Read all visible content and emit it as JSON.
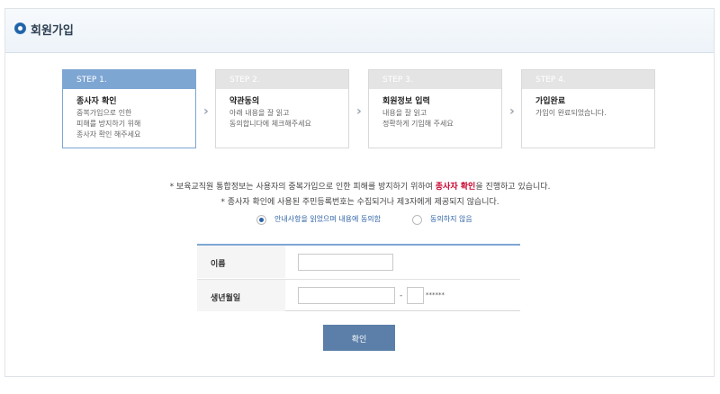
{
  "header": {
    "title": "회원가입"
  },
  "steps": [
    {
      "label": "STEP 1.",
      "title": "종사자 확인",
      "desc": [
        "중복가입으로 인한",
        "피해를 방지하기 위해",
        "종사자 확인 해주세요"
      ]
    },
    {
      "label": "STEP 2.",
      "title": "약관동의",
      "desc": [
        "아래 내용을 잘 읽고",
        "동의합니다에 체크해주세요"
      ]
    },
    {
      "label": "STEP 3.",
      "title": "회원정보 입력",
      "desc": [
        "내용을 잘 읽고",
        "정확하게 기입해 주세요"
      ]
    },
    {
      "label": "STEP 4.",
      "title": "가입완료",
      "desc": [
        "가입이 완료되었습니다."
      ]
    }
  ],
  "notice": {
    "line1_before": "* 보육교직원 통합정보는 사용자의 중복가입으로 인한 피해를 방지하기 위하여 ",
    "line1_highlight": "종사자 확인",
    "line1_after": "을 진행하고 있습니다.",
    "line2": "* 종사자 확인에 사용된 주민등록번호는 수집되거나 제3자에게 제공되지 않습니다."
  },
  "agreement": {
    "agree_label": "안내사항을 읽었으며 내용에 동의함",
    "disagree_label": "동의하지 않음",
    "selected": "agree"
  },
  "form": {
    "name_label": "이름",
    "name_value": "",
    "birth_label": "생년월일",
    "birth_value": "",
    "separator": "-",
    "gender_value": "",
    "mask": "******"
  },
  "confirm_label": "확인"
}
